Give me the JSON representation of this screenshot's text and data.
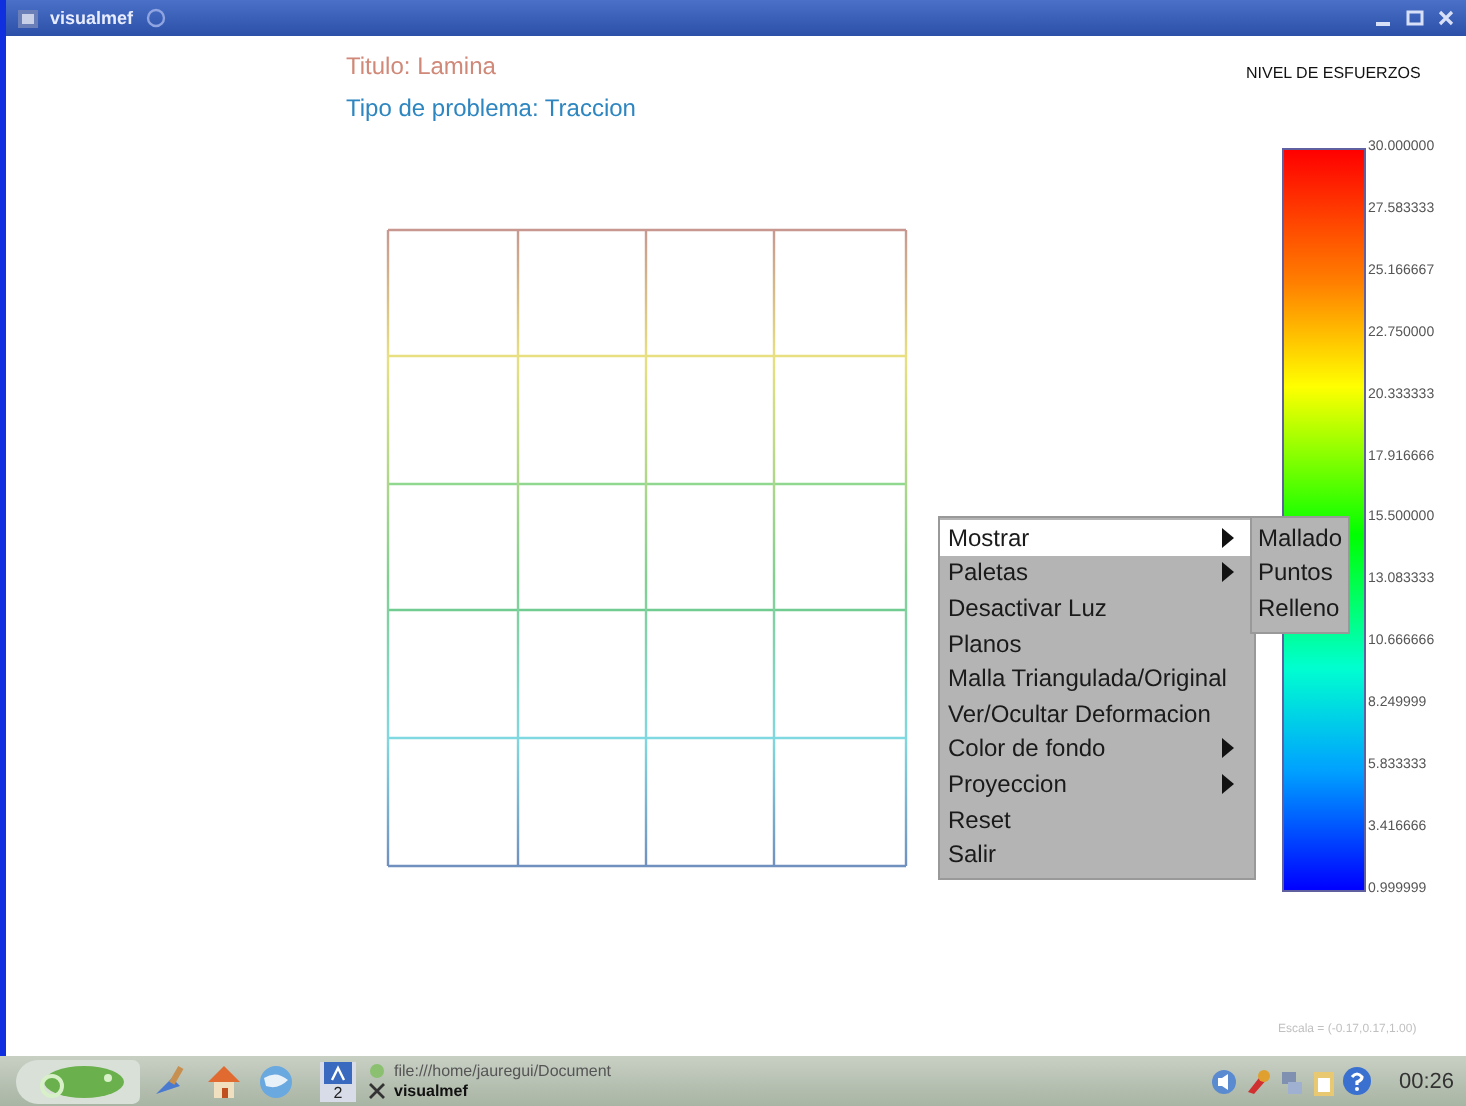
{
  "window": {
    "title": "visualmef"
  },
  "header": {
    "title": "Titulo: Lamina",
    "problem_type": "Tipo de problema: Traccion"
  },
  "legend": {
    "title": "NIVEL DE ESFUERZOS",
    "labels": [
      "30.000000",
      "27.583333",
      "25.166667",
      "22.750000",
      "20.333333",
      "17.916666",
      "15.500000",
      "13.083333",
      "10.666666",
      "8.249999",
      "5.833333",
      "3.416666",
      "0.999999"
    ]
  },
  "scale": "Escala = (-0.17,0.17,1.00)",
  "context_menu": {
    "items": [
      {
        "label": "Mostrar",
        "submenu": true,
        "selected": true
      },
      {
        "label": "Paletas",
        "submenu": true,
        "selected": false
      },
      {
        "label": "Desactivar Luz",
        "submenu": false,
        "selected": false
      },
      {
        "label": "Planos",
        "submenu": false,
        "selected": false
      },
      {
        "label": "Malla Triangulada/Original",
        "submenu": false,
        "selected": false
      },
      {
        "label": "Ver/Ocultar Deformacion",
        "submenu": false,
        "selected": false
      },
      {
        "label": "Color de fondo",
        "submenu": true,
        "selected": false
      },
      {
        "label": "Proyeccion",
        "submenu": true,
        "selected": false
      },
      {
        "label": "Reset",
        "submenu": false,
        "selected": false
      },
      {
        "label": "Salir",
        "submenu": false,
        "selected": false
      }
    ],
    "submenu_items": [
      "Mallado",
      "Puntos",
      "Relleno"
    ]
  },
  "taskbar": {
    "pager": "2",
    "tasks": [
      {
        "label": "file:///home/jauregui/Document",
        "active": false
      },
      {
        "label": "visualmef",
        "active": true
      }
    ],
    "clock": "00:26"
  }
}
